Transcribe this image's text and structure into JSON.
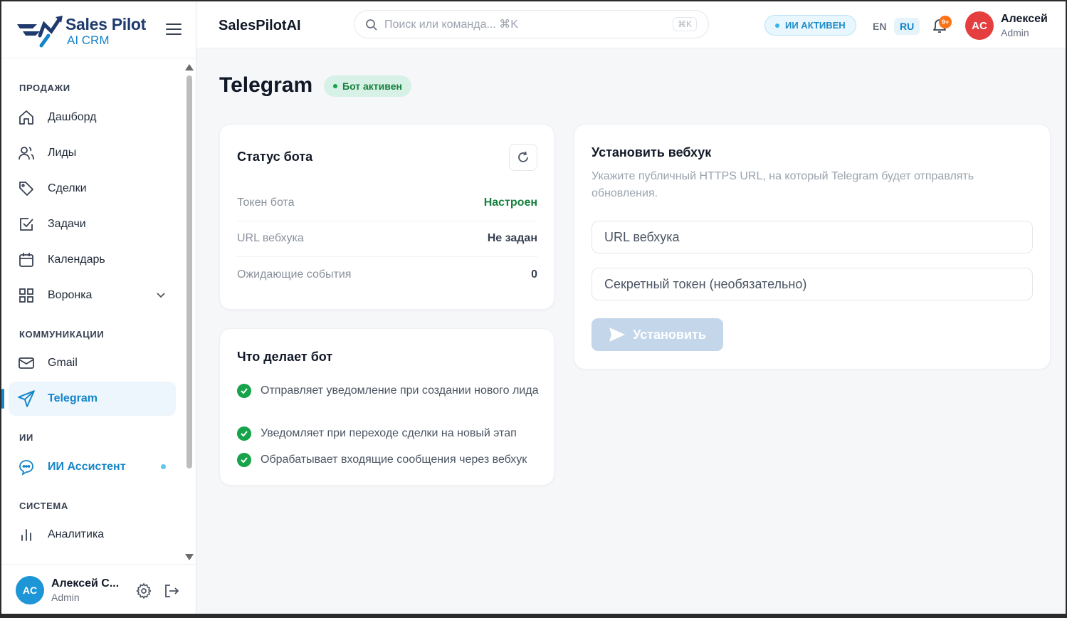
{
  "brand": {
    "name": "Sales Pilot",
    "subtitle": "AI CRM"
  },
  "sidebar": {
    "sections": [
      {
        "title": "ПРОДАЖИ",
        "items": [
          {
            "label": "Дашборд",
            "icon": "home-icon"
          },
          {
            "label": "Лиды",
            "icon": "users-icon"
          },
          {
            "label": "Сделки",
            "icon": "tag-icon"
          },
          {
            "label": "Задачи",
            "icon": "checkbox-icon"
          },
          {
            "label": "Календарь",
            "icon": "calendar-icon"
          },
          {
            "label": "Воронка",
            "icon": "grid-icon",
            "expandable": true
          }
        ]
      },
      {
        "title": "КОММУНИКАЦИИ",
        "items": [
          {
            "label": "Gmail",
            "icon": "mail-icon"
          },
          {
            "label": "Telegram",
            "icon": "send-icon",
            "active": true
          }
        ]
      },
      {
        "title": "ИИ",
        "items": [
          {
            "label": "ИИ Ассистент",
            "icon": "ai-bot-icon",
            "indicator": true
          }
        ]
      },
      {
        "title": "СИСТЕМА",
        "items": [
          {
            "label": "Аналитика",
            "icon": "bar-chart-icon"
          }
        ]
      }
    ],
    "user": {
      "initials": "AC",
      "name": "Алексей С...",
      "role": "Admin"
    }
  },
  "topbar": {
    "app_title": "SalesPilotAI",
    "search_placeholder": "Поиск или команда... ⌘K",
    "search_kbd": "⌘K",
    "ai_status": "ИИ АКТИВЕН",
    "lang_en": "EN",
    "lang_ru": "RU",
    "notifications_badge": "9+",
    "user": {
      "initials": "AC",
      "name": "Алексей",
      "role": "Admin"
    }
  },
  "page": {
    "title": "Telegram",
    "status": "Бот активен",
    "bot_status": {
      "title": "Статус бота",
      "rows": [
        {
          "key": "Токен бота",
          "value": "Настроен",
          "color": "#15803d"
        },
        {
          "key": "URL вебхука",
          "value": "Не задан"
        },
        {
          "key": "Ожидающие события",
          "value": "0"
        }
      ]
    },
    "features": {
      "title": "Что делает бот",
      "items": [
        "Отправляет уведомление при создании нового лида",
        "Уведомляет при переходе сделки на новый этап",
        "Обрабатывает входящие сообщения через вебхук"
      ]
    },
    "webhook": {
      "title": "Установить вебхук",
      "hint": "Укажите публичный HTTPS URL, на который Telegram будет отправлять обновления.",
      "url_placeholder": "URL вебхука",
      "secret_placeholder": "Секретный токен (необязательно)",
      "button": "Установить"
    }
  },
  "colors": {
    "accent": "#1485c8",
    "success": "#16a34a",
    "danger_avatar": "#e53e3e",
    "brand_dark": "#1e3a6e"
  }
}
